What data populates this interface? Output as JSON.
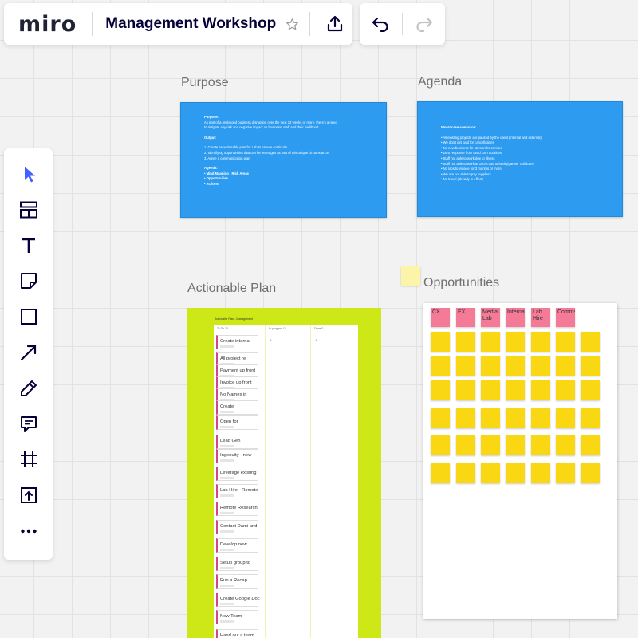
{
  "app": {
    "logo": "miro",
    "board_title": "Management Workshop"
  },
  "frames": {
    "purpose": {
      "label": "Purpose",
      "lines": [
        {
          "t": "Purpose:",
          "b": true
        },
        {
          "t": "As part of a prolonged business disruption over the next 12 weeks or more, there's a need"
        },
        {
          "t": "to mitigate any risk and negative impact on business, staff and their livelihood"
        },
        {
          "t": "",
          "gap": true
        },
        {
          "t": "Output:",
          "b": true
        },
        {
          "t": "",
          "gap": true
        },
        {
          "t": "1. Create an actionable plan for Lab to ensure continuity"
        },
        {
          "t": "2. Identifying opportunities that can be leverages as part of this unique circumstance"
        },
        {
          "t": "3. Agree a communication plan"
        },
        {
          "t": "",
          "gap": true
        },
        {
          "t": "Agenda:",
          "b": true
        },
        {
          "t": "•  Mind Mapping - Risk Areas",
          "b": true
        },
        {
          "t": "•  Opportunities",
          "b": true
        },
        {
          "t": "•  Actions",
          "b": true
        }
      ]
    },
    "agenda": {
      "label": "Agenda",
      "lines": [
        {
          "t": "Worst case scenarios:",
          "b": true
        },
        {
          "t": "",
          "gap": true
        },
        {
          "t": "•  All existing projects are paused by the client (internal and external)"
        },
        {
          "t": "•  We don't get paid for cancellations"
        },
        {
          "t": "•  No new business for 12 months or more"
        },
        {
          "t": "•  Zero response from Lead Gen activities"
        },
        {
          "t": "•  Staff not able to work due to illness"
        },
        {
          "t": "•  Staff not able to work at 100% due to family/partner childcare"
        },
        {
          "t": "•  No labs to invoice for 3 months or more"
        },
        {
          "t": "•  We are not able to pay suppliers"
        },
        {
          "t": "•  No travel (already in effect)"
        }
      ]
    },
    "plan": {
      "label": "Actionable Plan",
      "board_title": "Actionable Plan - Management",
      "columns": [
        {
          "name": "To Do",
          "count": "20"
        },
        {
          "name": "In progress",
          "count": "0"
        },
        {
          "name": "Done",
          "count": "0"
        }
      ],
      "cards": [
        "Create internal",
        "All project re",
        "Payment up front",
        "Invoice up front",
        "No Names in",
        "Create",
        "Open for",
        "Lead Gen",
        "Ingenuity - new",
        "Leverage existing",
        "Lab Hire - Remote",
        "Remote Research",
        "Contact Dami and",
        "Develop new",
        "Setup group to",
        "Run a Recap",
        "Create Google Doc",
        "New Team",
        "Hand out a team"
      ]
    },
    "opportunities": {
      "label": "Opportunities",
      "headers": [
        "CX",
        "EX",
        "Media Lab",
        "Internal",
        "Lab Hire",
        "Comms"
      ],
      "rows": 6
    }
  },
  "colors": {
    "blue_card": "#2d9bf0",
    "plan_frame": "#cde816",
    "pink_note": "#f47a98",
    "yellow_note": "#f9d712",
    "tool_active": "#4262ff"
  },
  "toolbar": {
    "tools": [
      "select-icon",
      "templates-icon",
      "text-icon",
      "sticky-note-icon",
      "shape-icon",
      "arrow-icon",
      "pen-icon",
      "comment-icon",
      "frame-icon",
      "upload-icon",
      "more-icon"
    ]
  }
}
